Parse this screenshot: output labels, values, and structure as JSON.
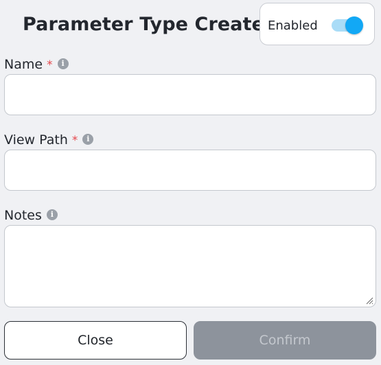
{
  "dialog": {
    "title": "Parameter Type Create"
  },
  "enabled_toggle": {
    "label": "Enabled",
    "state": "on",
    "accent_color": "#12a8f5"
  },
  "fields": {
    "name": {
      "label": "Name",
      "required_marker": "*",
      "info_icon": "info-icon",
      "value": ""
    },
    "view_path": {
      "label": "View Path",
      "required_marker": "*",
      "info_icon": "info-icon",
      "value": ""
    },
    "notes": {
      "label": "Notes",
      "info_icon": "info-icon",
      "value": ""
    }
  },
  "actions": {
    "close_label": "Close",
    "confirm_label": "Confirm",
    "confirm_state": "disabled"
  },
  "colors": {
    "required": "#e5484d",
    "confirm_disabled_bg": "#8d939c"
  }
}
